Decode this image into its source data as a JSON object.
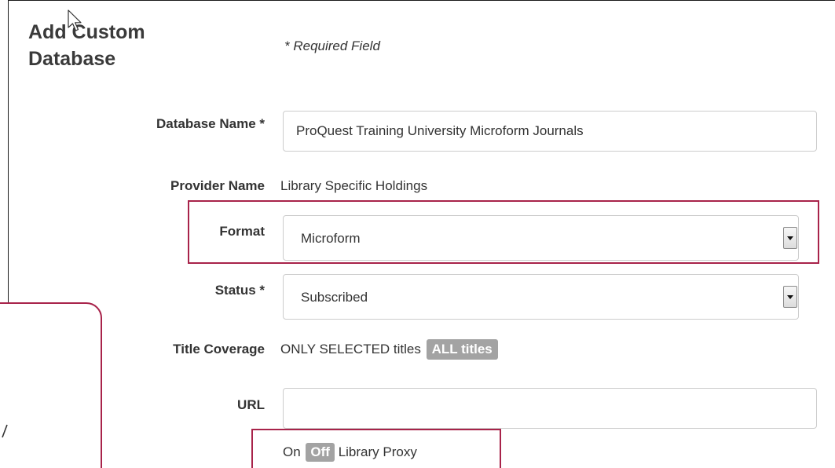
{
  "page": {
    "title": "Add Custom Database",
    "required_note": "* Required Field"
  },
  "form": {
    "database_name": {
      "label": "Database Name *",
      "value": "ProQuest Training University Microform Journals"
    },
    "provider_name": {
      "label": "Provider Name",
      "value": "Library Specific Holdings"
    },
    "format": {
      "label": "Format",
      "selected": "Microform"
    },
    "status": {
      "label": "Status *",
      "selected": "Subscribed"
    },
    "title_coverage": {
      "label": "Title Coverage",
      "option_selected_text": "ONLY SELECTED titles",
      "option_all": "ALL titles"
    },
    "url": {
      "label": "URL",
      "value": "",
      "proxy_on": "On",
      "proxy_off": "Off",
      "proxy_label": "Library Proxy"
    }
  },
  "colors": {
    "highlight": "#a8234a",
    "toggle_active_bg": "#a3a3a3"
  },
  "icons": {
    "cursor": "mouse-pointer-icon",
    "dropdown": "chevron-down-icon"
  }
}
